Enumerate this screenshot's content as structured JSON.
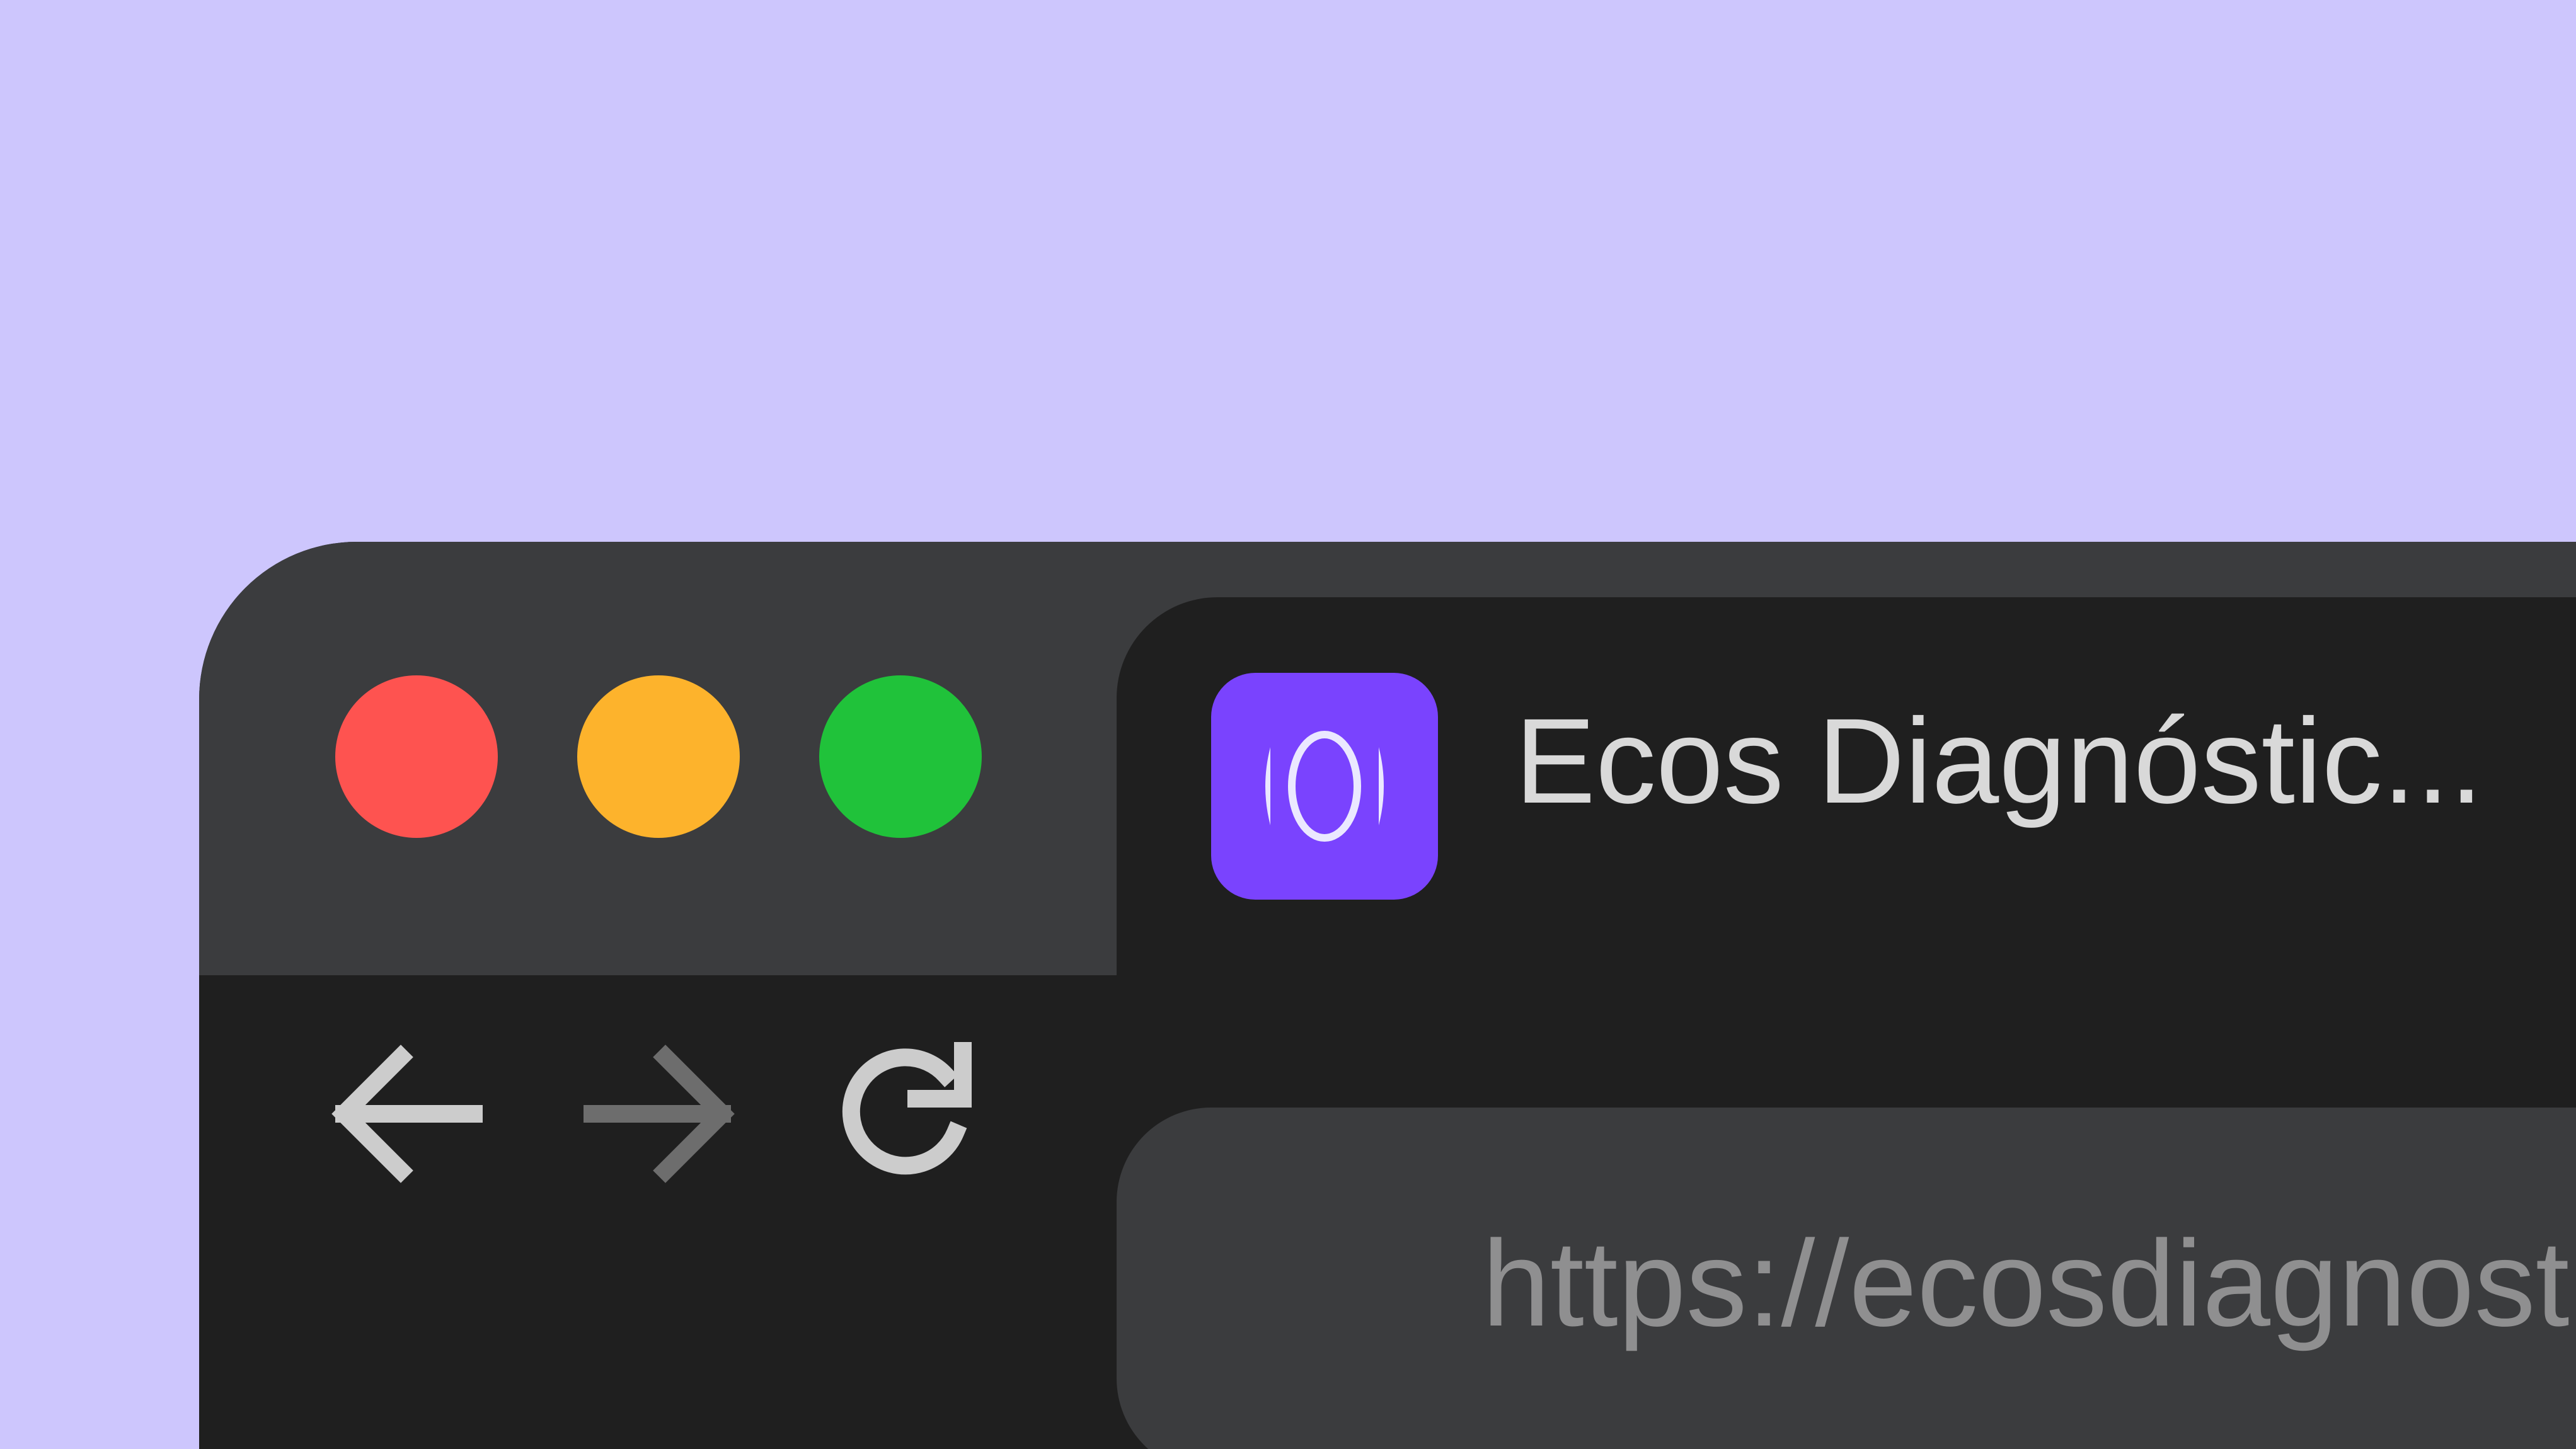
{
  "window": {
    "controls": {
      "close": "close-button",
      "minimize": "minimize-button",
      "zoom": "zoom-button"
    }
  },
  "tab": {
    "favicon_icon": "ecos-logo-icon",
    "title": "Ecos Diagnóstic..."
  },
  "toolbar": {
    "back_icon": "arrow-left-icon",
    "forward_icon": "arrow-right-icon",
    "reload_icon": "reload-icon"
  },
  "address_bar": {
    "url": "https://ecosdiagnostic"
  },
  "colors": {
    "background": "#cdc6fd",
    "titlebar": "#3b3c3e",
    "window": "#1f1f1f",
    "close": "#fe5350",
    "minimize": "#fdb32c",
    "zoom": "#20c23a",
    "favicon": "#7a43fe"
  }
}
